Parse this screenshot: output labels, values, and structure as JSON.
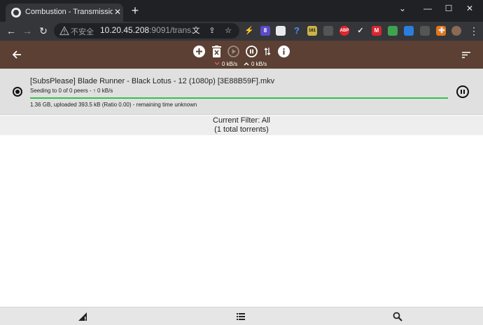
{
  "browser": {
    "tab": {
      "title": "Combustion - Transmission W",
      "close_glyph": "✕"
    },
    "new_tab_glyph": "+",
    "window_controls": {
      "chevron": "⌄",
      "minimize": "—",
      "maximize": "☐",
      "close": "✕"
    },
    "toolbar": {
      "back_glyph": "←",
      "forward_glyph": "→",
      "reload_glyph": "↻"
    },
    "address": {
      "security_label": "不安全",
      "host": "10.20.45.208",
      "rest": ":9091/trans..."
    },
    "extensions": [
      {
        "name": "lightning-icon",
        "badge": "",
        "color": "#35363a"
      },
      {
        "name": "extension-badge-icon",
        "badge": "8",
        "color": "#5c4bc8"
      },
      {
        "name": "cloud-icon",
        "badge": "",
        "color": "#e8eaed"
      },
      {
        "name": "help-icon",
        "badge": "",
        "color": "#4d8ff5"
      },
      {
        "name": "counter-extension-icon",
        "badge": "161",
        "color": "#c9b44a"
      },
      {
        "name": "glasses-icon",
        "badge": "",
        "color": "#555"
      },
      {
        "name": "adblock-icon",
        "badge": "ABP",
        "color": "#e0262c"
      },
      {
        "name": "check-icon",
        "badge": "",
        "color": "#35363a"
      },
      {
        "name": "mega-icon",
        "badge": "M",
        "color": "#d9272e"
      },
      {
        "name": "duck-icon",
        "badge": "",
        "color": "#3fa34d"
      },
      {
        "name": "globe-icon",
        "badge": "",
        "color": "#2b7de0"
      },
      {
        "name": "pocket-icon",
        "badge": "",
        "color": "#555"
      },
      {
        "name": "fox-icon",
        "badge": "",
        "color": "#e2761b"
      },
      {
        "name": "puzzle-icon",
        "badge": "",
        "color": "#35363a"
      },
      {
        "name": "profile-avatar",
        "badge": "",
        "color": "#8a6a55"
      }
    ],
    "menu_glyph": "⋮"
  },
  "app": {
    "colors": {
      "header": "#5b4033",
      "progress": "#33c24d"
    },
    "header": {
      "download_rate": "0 kB/s",
      "upload_rate": "0 kB/s"
    },
    "torrent": {
      "name": "[SubsPlease] Blade Runner - Black Lotus - 12 (1080p) [3E88B59F].mkv",
      "status": "Seeding to 0 of 0 peers - ↑ 0 kB/s",
      "progress": 1.0,
      "details": "1.36 GB, uploaded 393.5 kB (Ratio 0.00) - remaining time unknown"
    },
    "filter": {
      "line1": "Current Filter: All",
      "line2": "(1 total torrents)"
    }
  }
}
